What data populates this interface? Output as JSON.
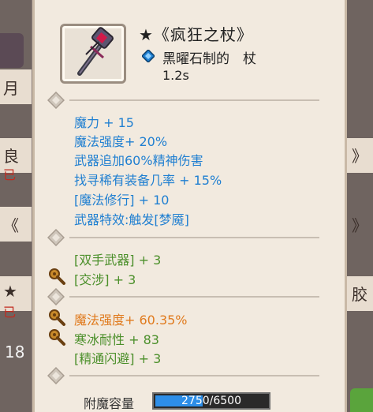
{
  "item": {
    "name": "★《疯狂之杖》",
    "material_line": "黑曜石制的　杖",
    "attack_speed": "1.2s"
  },
  "stats_group1": [
    {
      "text": "魔力 + 15"
    },
    {
      "text": "魔法强度+ 20%"
    },
    {
      "text": "武器追加60%精神伤害"
    },
    {
      "text": "找寻稀有装备几率 + 15%"
    },
    {
      "text": "[魔法修行] + 10"
    },
    {
      "text": "武器特效:触发[梦魇]"
    }
  ],
  "stats_group2": [
    {
      "text": "[双手武器] + 3"
    },
    {
      "text": "[交涉] + 3"
    }
  ],
  "stats_group3": [
    {
      "text": "魔法强度+ 60.35%"
    },
    {
      "text": "寒冰耐性 + 83"
    },
    {
      "text": "[精通闪避] + 3"
    }
  ],
  "enchant": {
    "label": "附魔容量",
    "value": "2750/6500",
    "current": 2750,
    "max": 6500
  },
  "background": {
    "left_texts": [
      "月",
      "良",
      "已",
      "《",
      "★",
      "已",
      "18"
    ],
    "right_texts": [
      "》",
      "》",
      "胶"
    ]
  },
  "colors": {
    "stat_blue": "#1f7fd1",
    "stat_green": "#4b8f2a",
    "stat_orange": "#e07a1d",
    "bar_fill": "#2d8ee8"
  }
}
